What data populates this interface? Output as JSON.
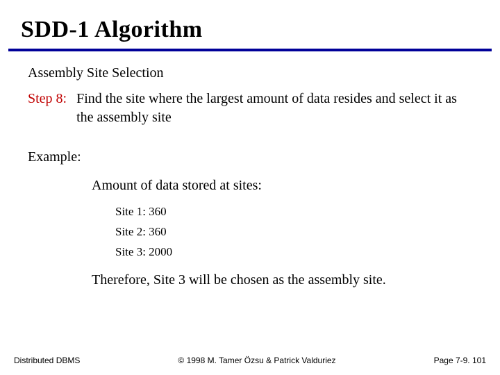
{
  "title": "SDD-1 Algorithm",
  "section_heading": "Assembly Site Selection",
  "step": {
    "label": "Step 8:",
    "body": "Find the site where the largest amount of data resides and select it as the assembly site"
  },
  "example": {
    "heading": "Example:",
    "amount_line": "Amount of data stored at sites:",
    "sites": [
      "Site 1: 360",
      "Site 2: 360",
      "Site 3: 2000"
    ],
    "conclusion": "Therefore, Site 3 will be chosen as the assembly site."
  },
  "footer": {
    "left": "Distributed DBMS",
    "center": "© 1998 M. Tamer Özsu & Patrick Valduriez",
    "right": "Page 7-9. 101"
  }
}
